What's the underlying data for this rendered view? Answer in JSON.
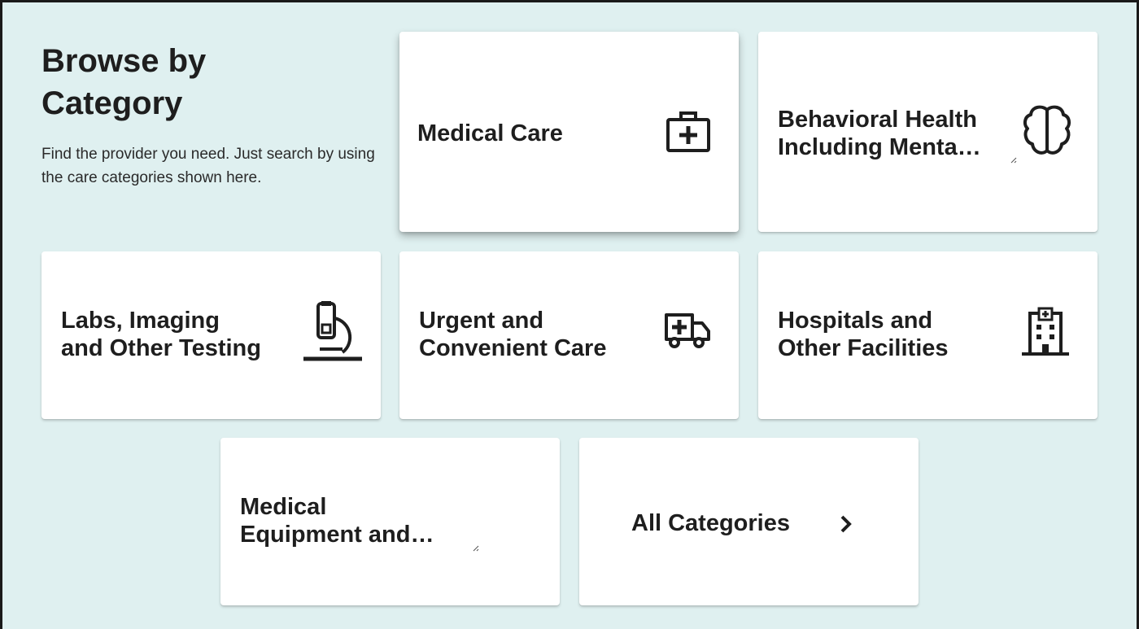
{
  "section": {
    "title": "Browse by Category",
    "description": "Find the provider you need. Just search by using the care categories shown here."
  },
  "categories": [
    {
      "label": "Medical Care",
      "icon": "medical-kit-icon"
    },
    {
      "label": "Behavioral Health\nIncluding Menta…",
      "icon": "brain-icon"
    },
    {
      "label": "Labs, Imaging\nand Other Testing",
      "icon": "microscope-icon"
    },
    {
      "label": "Urgent and\nConvenient Care",
      "icon": "ambulance-icon"
    },
    {
      "label": "Hospitals and\nOther Facilities",
      "icon": "hospital-building-icon"
    },
    {
      "label": "Medical\nEquipment and…",
      "icon": ""
    },
    {
      "label": "All Categories",
      "icon": "chevron-right-icon"
    }
  ],
  "colors": {
    "background": "#dff0f0",
    "card": "#ffffff",
    "text": "#1e1e1e"
  }
}
